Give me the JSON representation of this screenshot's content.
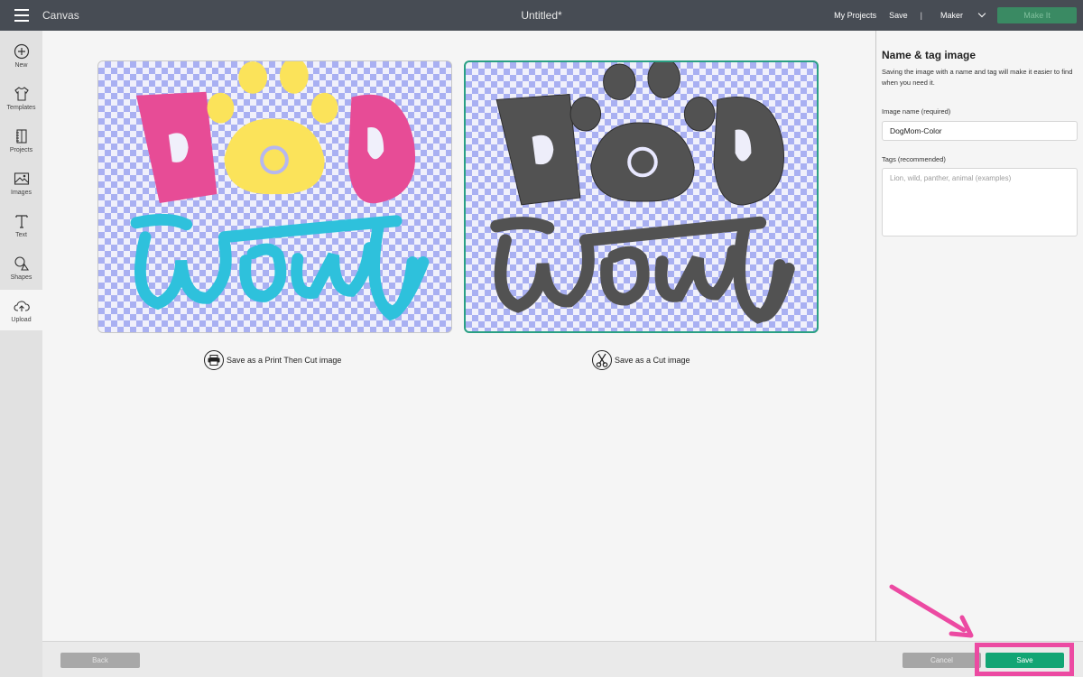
{
  "topbar": {
    "app_title": "Canvas",
    "doc_title": "Untitled*",
    "my_projects": "My Projects",
    "save": "Save",
    "separator": "|",
    "machine": "Maker",
    "make_it": "Make It"
  },
  "sidebar": {
    "items": [
      {
        "label": "New",
        "icon": "plus-circle-icon"
      },
      {
        "label": "Templates",
        "icon": "tshirt-icon"
      },
      {
        "label": "Projects",
        "icon": "notebook-icon"
      },
      {
        "label": "Images",
        "icon": "image-icon"
      },
      {
        "label": "Text",
        "icon": "text-icon"
      },
      {
        "label": "Shapes",
        "icon": "shapes-icon"
      },
      {
        "label": "Upload",
        "icon": "upload-cloud-icon"
      }
    ],
    "active": "Upload"
  },
  "main": {
    "print_option": {
      "label": "Save as a Print Then Cut image",
      "icon": "printer-icon"
    },
    "cut_option": {
      "label": "Save as a Cut image",
      "icon": "scissors-icon",
      "selected": true
    },
    "print_preview_colors": {
      "pink": "#e74c96",
      "yellow": "#fbe35a",
      "cyan": "#2ec1dc"
    },
    "cut_preview_color": "#525252"
  },
  "panel": {
    "title": "Name & tag image",
    "description": "Saving the image with a name and tag will make it easier to find when you need it.",
    "name_label": "Image name (required)",
    "name_value": "DogMom-Color",
    "tags_label": "Tags (recommended)",
    "tags_placeholder": "Lion, wild, panther, animal (examples)"
  },
  "footer": {
    "back": "Back",
    "cancel": "Cancel",
    "save": "Save"
  },
  "colors": {
    "topbar": "#474c54",
    "accent_green": "#12a574",
    "selected_border": "#2aa084",
    "highlight_pink": "#ec4aa2"
  }
}
